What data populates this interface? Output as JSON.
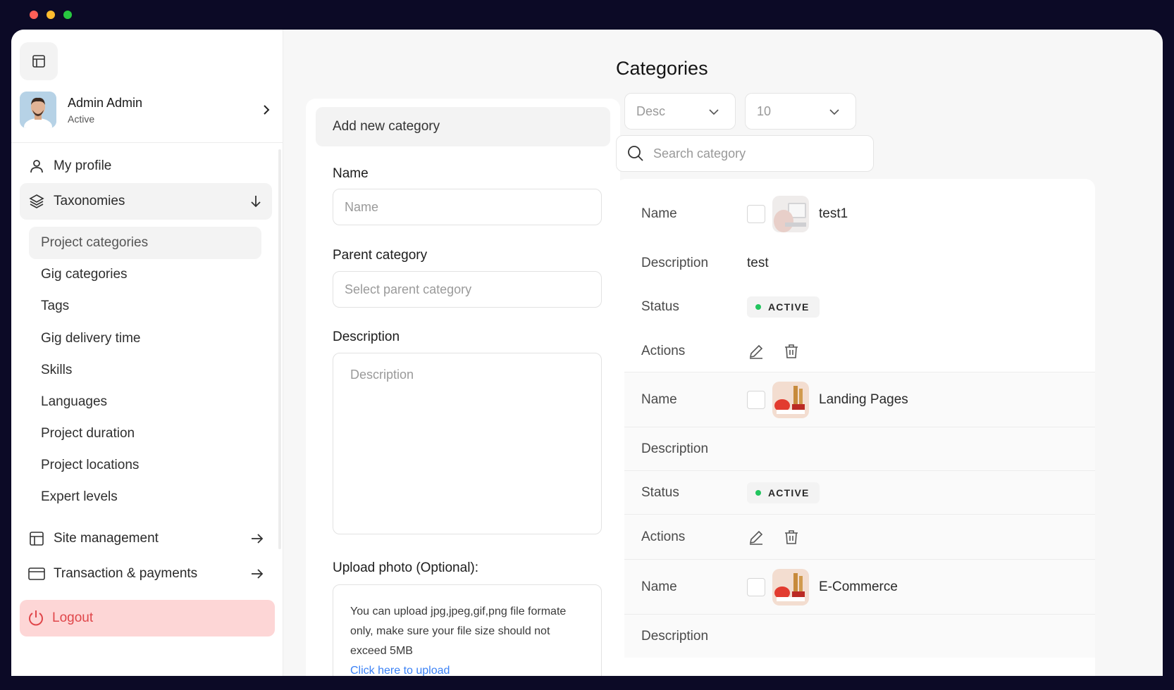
{
  "colors": {
    "accent_danger": "#e0464a",
    "logout_bg": "#fdd6d6",
    "status_active": "#22c55e",
    "link": "#3b82f6"
  },
  "window_controls": [
    "#ff5f57",
    "#febc2e",
    "#28c840"
  ],
  "sidebar": {
    "layout_icon": "layout-icon",
    "profile": {
      "name": "Admin Admin",
      "status": "Active"
    },
    "items": {
      "my_profile": "My profile",
      "taxonomies": "Taxonomies",
      "site_management": "Site management",
      "transactions": "Transaction & payments"
    },
    "sub_items": [
      "Project categories",
      "Gig categories",
      "Tags",
      "Gig delivery time",
      "Skills",
      "Languages",
      "Project duration",
      "Project locations",
      "Expert levels"
    ],
    "logout": "Logout"
  },
  "form": {
    "header": "Add new category",
    "name_label": "Name",
    "name_placeholder": "Name",
    "parent_label": "Parent category",
    "parent_placeholder": "Select parent category",
    "description_label": "Description",
    "description_placeholder": "Description",
    "upload_label": "Upload photo (Optional):",
    "upload_hint": "You can upload jpg,jpeg,gif,png file formate only, make sure your file size should not exceed 5MB",
    "upload_link": "Click here to upload"
  },
  "categories": {
    "title": "Categories",
    "sort_value": "Desc",
    "per_page_value": "10",
    "search_placeholder": "Search category",
    "labels": {
      "name": "Name",
      "description": "Description",
      "status": "Status",
      "actions": "Actions"
    },
    "items": [
      {
        "name": "test1",
        "description": "test",
        "status": "ACTIVE"
      },
      {
        "name": "Landing Pages",
        "description": "",
        "status": "ACTIVE"
      },
      {
        "name": "E-Commerce",
        "description": "",
        "status": ""
      }
    ]
  }
}
